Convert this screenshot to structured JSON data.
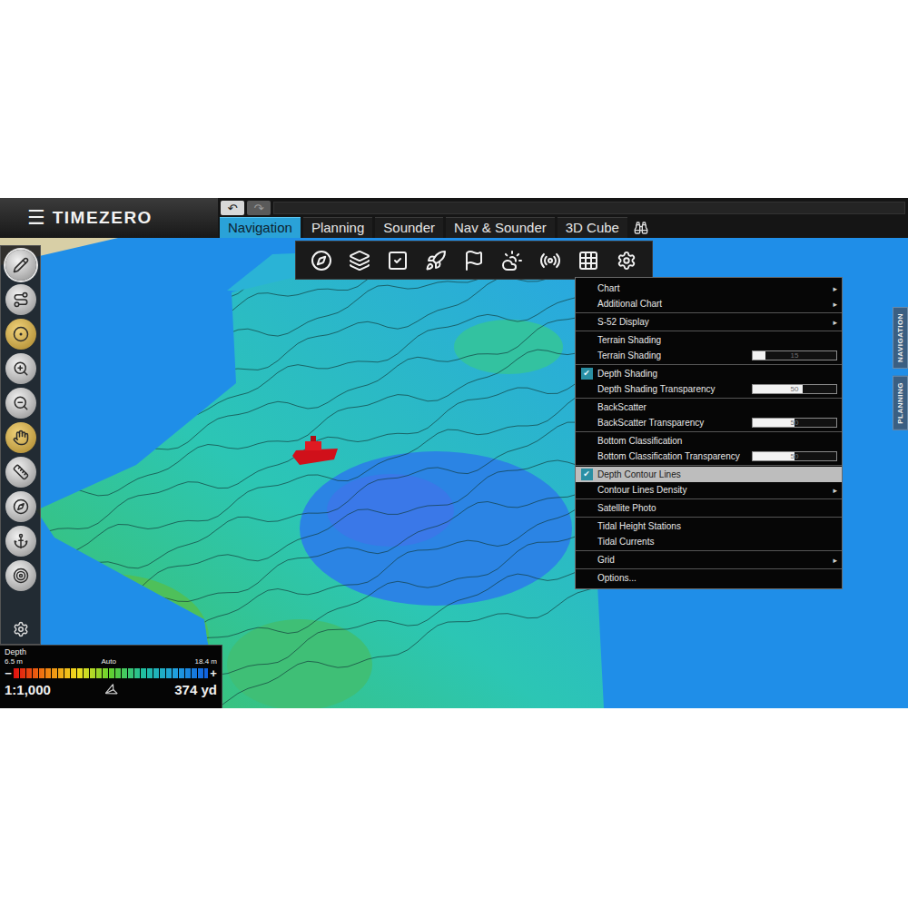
{
  "app": {
    "menu_icon": "☰",
    "logo": "TIMEZERO"
  },
  "history": [
    {
      "icon": "↶",
      "disabled": false
    },
    {
      "icon": "↷",
      "disabled": true
    }
  ],
  "tabs": [
    {
      "label": "Navigation",
      "selected": true
    },
    {
      "label": "Planning",
      "selected": false
    },
    {
      "label": "Sounder",
      "selected": false
    },
    {
      "label": "Nav & Sounder",
      "selected": false
    },
    {
      "label": "3D Cube",
      "selected": false
    }
  ],
  "left_tools": [
    {
      "selected": true
    },
    {
      "selected": false
    },
    {
      "selected": false
    },
    {
      "selected": false
    },
    {
      "selected": false
    },
    {
      "selected": false
    },
    {
      "selected": false
    },
    {
      "selected": false
    },
    {
      "selected": false
    },
    {
      "selected": false
    }
  ],
  "menu": {
    "check_mark": "✔",
    "submenu_arrow": "▸",
    "groups": [
      [
        {
          "label": "Chart",
          "kind": "submenu",
          "checked": false,
          "highlighted": false
        },
        {
          "label": "Additional Chart",
          "kind": "submenu",
          "checked": false,
          "highlighted": false
        }
      ],
      [
        {
          "label": "S-52 Display",
          "kind": "submenu",
          "checked": false,
          "highlighted": false
        }
      ],
      [
        {
          "label": "Terrain Shading",
          "kind": "item",
          "checked": false,
          "highlighted": false
        },
        {
          "label": "Terrain Shading",
          "kind": "slider",
          "checked": false,
          "highlighted": false,
          "level": 0.15,
          "reading": "15"
        }
      ],
      [
        {
          "label": "Depth Shading",
          "kind": "item",
          "checked": true,
          "highlighted": false
        },
        {
          "label": "Depth Shading Transparency",
          "kind": "slider",
          "checked": false,
          "highlighted": false,
          "level": 0.6,
          "reading": "50"
        }
      ],
      [
        {
          "label": "BackScatter",
          "kind": "item",
          "checked": false,
          "highlighted": false
        },
        {
          "label": "BackScatter Transparency",
          "kind": "slider",
          "checked": false,
          "highlighted": false,
          "level": 0.5,
          "reading": "50"
        }
      ],
      [
        {
          "label": "Bottom Classification",
          "kind": "item",
          "checked": false,
          "highlighted": false
        },
        {
          "label": "Bottom Classification Transparency",
          "kind": "slider",
          "checked": false,
          "highlighted": false,
          "level": 0.5,
          "reading": "50"
        }
      ],
      [
        {
          "label": "Depth Contour Lines",
          "kind": "item",
          "checked": true,
          "highlighted": true
        },
        {
          "label": "Contour Lines Density",
          "kind": "submenu",
          "checked": false,
          "highlighted": false
        }
      ],
      [
        {
          "label": "Satellite Photo",
          "kind": "item",
          "checked": false,
          "highlighted": false
        }
      ],
      [
        {
          "label": "Tidal Height Stations",
          "kind": "item",
          "checked": false,
          "highlighted": false
        },
        {
          "label": "Tidal Currents",
          "kind": "item",
          "checked": false,
          "highlighted": false
        }
      ],
      [
        {
          "label": "Grid",
          "kind": "submenu",
          "checked": false,
          "highlighted": false
        }
      ],
      [
        {
          "label": "Options...",
          "kind": "item",
          "checked": false,
          "highlighted": false
        }
      ]
    ]
  },
  "side_tabs": [
    "NAVIGATION",
    "PLANNING"
  ],
  "depth_legend": {
    "title": "Depth",
    "min": "6.5 m",
    "mode": "Auto",
    "max": "18.4 m",
    "minus": "−",
    "plus": "+"
  },
  "scale": {
    "ratio": "1:1,000",
    "distance": "374 yd"
  }
}
